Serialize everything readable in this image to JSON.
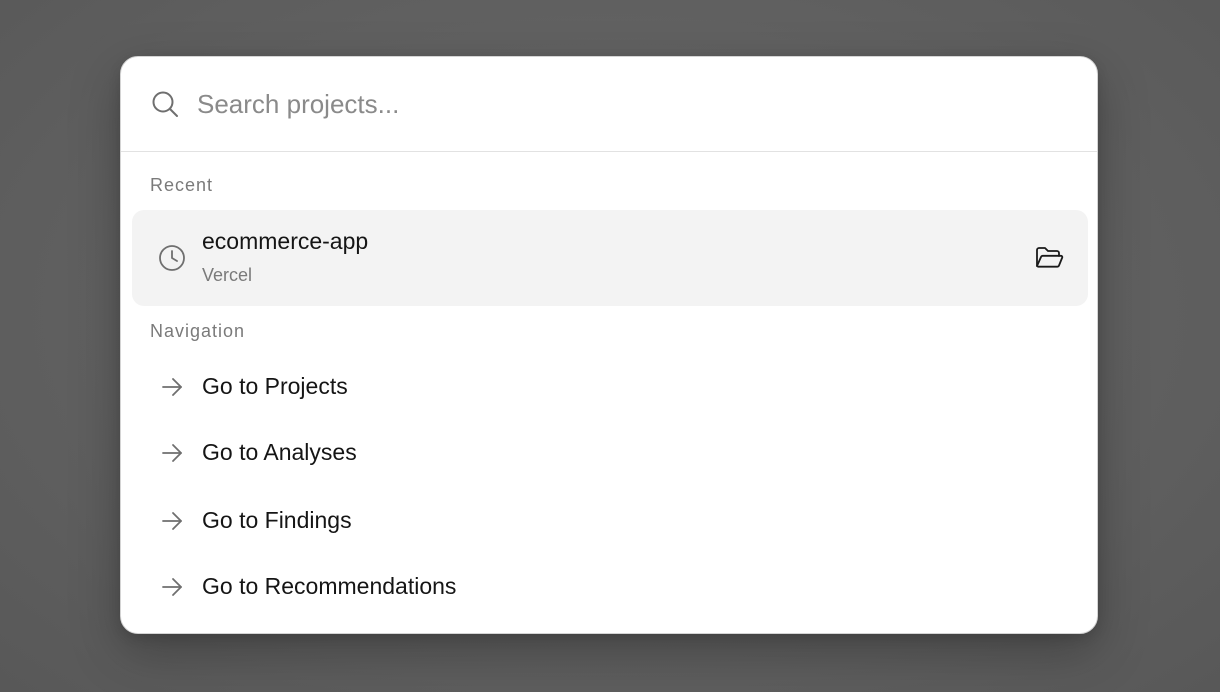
{
  "search": {
    "placeholder": "Search projects...",
    "value": ""
  },
  "sections": {
    "recent_heading": "Recent",
    "navigation_heading": "Navigation"
  },
  "recent": [
    {
      "title": "ecommerce-app",
      "subtitle": "Vercel",
      "icon": "clock-icon",
      "action_icon": "folder-open-icon"
    }
  ],
  "navigation": [
    {
      "label": "Go to Projects",
      "icon": "arrow-right-icon"
    },
    {
      "label": "Go to Analyses",
      "icon": "arrow-right-icon"
    },
    {
      "label": "Go to Findings",
      "icon": "arrow-right-icon"
    },
    {
      "label": "Go to Recommendations",
      "icon": "arrow-right-icon"
    }
  ],
  "colors": {
    "overlay": "#626262",
    "panel": "#ffffff",
    "selected_row": "#f3f3f3",
    "muted_text": "#7a7a7a",
    "primary_text": "#151515"
  }
}
